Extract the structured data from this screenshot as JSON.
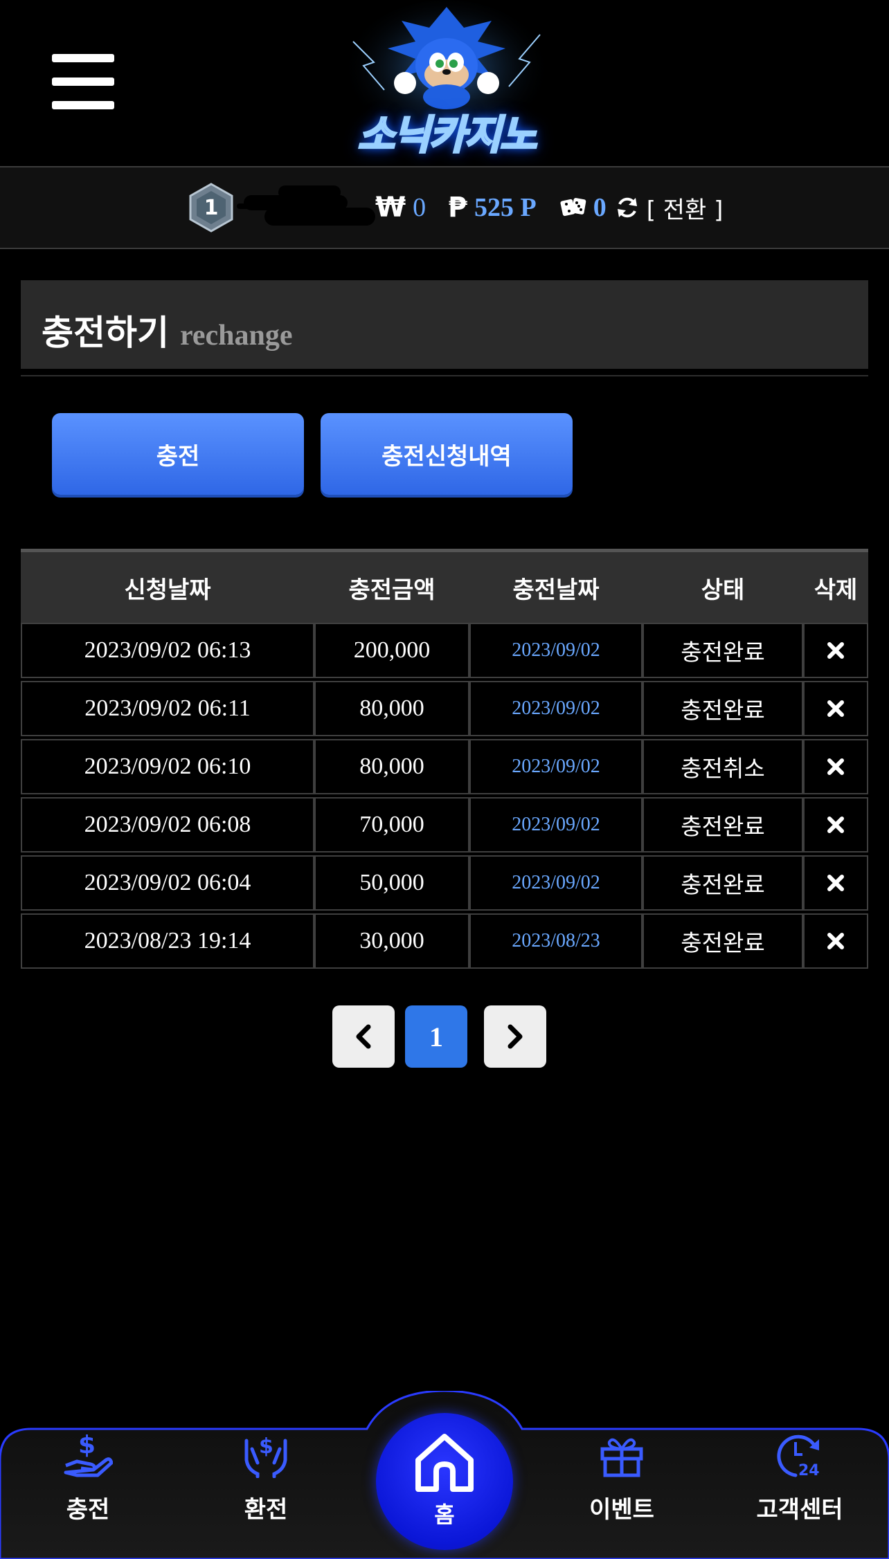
{
  "header": {
    "logo_text": "소닉카지노"
  },
  "status": {
    "level": "1",
    "won_symbol": "₩",
    "won_amount": "0",
    "point_symbol": "₱",
    "point_amount": "525 P",
    "casino_amount": "0",
    "switch_label": "[ 전환 ]"
  },
  "page": {
    "title": "충전하기",
    "subtitle": "rechange"
  },
  "tabs": [
    {
      "label": "충전"
    },
    {
      "label": "충전신청내역"
    }
  ],
  "table": {
    "headers": [
      "신청날짜",
      "충전금액",
      "충전날짜",
      "상태",
      "삭제"
    ],
    "rows": [
      {
        "request_date": "2023/09/02 06:13",
        "amount": "200,000",
        "charge_date": "2023/09/02",
        "status": "충전완료"
      },
      {
        "request_date": "2023/09/02 06:11",
        "amount": "80,000",
        "charge_date": "2023/09/02",
        "status": "충전완료"
      },
      {
        "request_date": "2023/09/02 06:10",
        "amount": "80,000",
        "charge_date": "2023/09/02",
        "status": "충전취소"
      },
      {
        "request_date": "2023/09/02 06:08",
        "amount": "70,000",
        "charge_date": "2023/09/02",
        "status": "충전완료"
      },
      {
        "request_date": "2023/09/02 06:04",
        "amount": "50,000",
        "charge_date": "2023/09/02",
        "status": "충전완료"
      },
      {
        "request_date": "2023/08/23 19:14",
        "amount": "30,000",
        "charge_date": "2023/08/23",
        "status": "충전완료"
      }
    ]
  },
  "pagination": {
    "current_page": "1"
  },
  "bottom_nav": [
    {
      "label": "충전",
      "icon": "deposit-hand-icon"
    },
    {
      "label": "환전",
      "icon": "exchange-hands-icon"
    },
    {
      "label": "홈",
      "icon": "home-icon"
    },
    {
      "label": "이벤트",
      "icon": "gift-icon"
    },
    {
      "label": "고객센터",
      "icon": "support-24-icon"
    }
  ],
  "colors": {
    "accent_blue": "#2f67e6",
    "link_blue": "#6aa8ff",
    "nav_blue": "#2b4dff",
    "home_blue": "#0b17d8"
  }
}
